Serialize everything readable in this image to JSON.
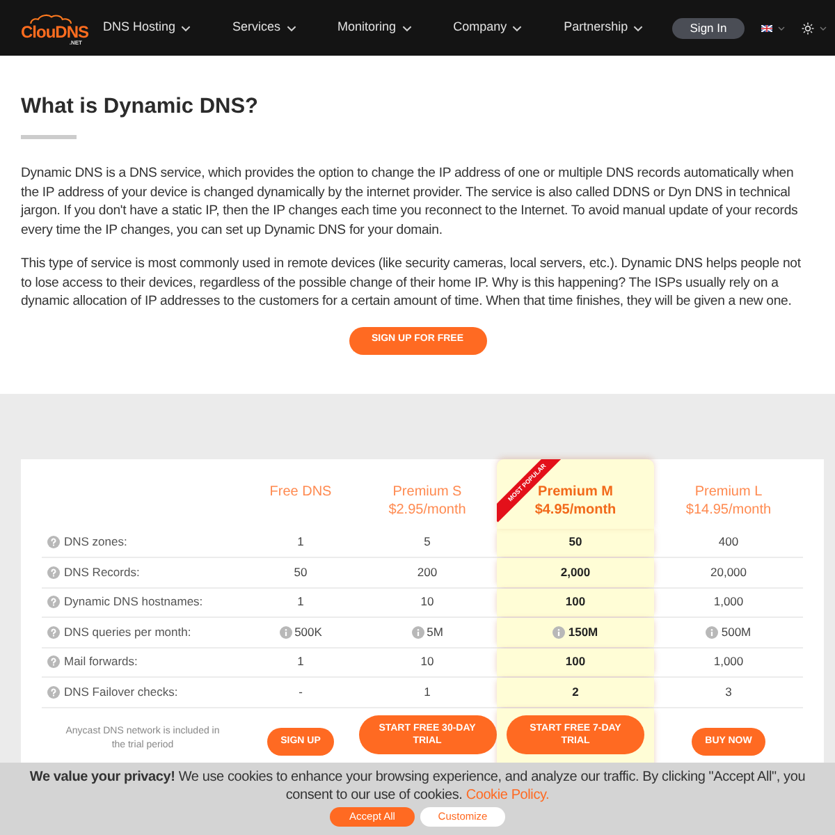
{
  "header": {
    "logo": {
      "text": "ClouDNS",
      "suffix": ".NET"
    },
    "nav": [
      {
        "label": "DNS Hosting"
      },
      {
        "label": "Services"
      },
      {
        "label": "Monitoring"
      },
      {
        "label": "Company"
      },
      {
        "label": "Partnership"
      }
    ],
    "sign_in": "Sign In",
    "dark_mode": false
  },
  "intro": {
    "title": "What is Dynamic DNS?",
    "paragraphs": [
      "Dynamic DNS is a DNS service, which provides the option to change the IP address of one or multiple DNS records automatically when the IP address of your device is changed dynamically by the internet provider. The service is also called DDNS or Dyn DNS in technical jargon. If you don't have a static IP, then the IP changes each time you reconnect to the Internet. To avoid manual update of your records every time the IP changes, you can set up Dynamic DNS for your domain.",
      "This type of service is most commonly used in remote devices (like security cameras, local servers, etc.). Dynamic DNS helps people not to lose access to their devices, regardless of the possible change of their home IP. Why is this happening? The ISPs usually rely on a dynamic allocation of IP addresses to the customers for a certain amount of time. When that time finishes, they will be given a new one."
    ],
    "button": "SIGN UP FOR FREE"
  },
  "pricing": {
    "plans": [
      {
        "name": "Free DNS",
        "featured": false
      },
      {
        "name": "Premium S",
        "price": "$2.95/month",
        "featured": false
      },
      {
        "name": "Premium M",
        "price": "$4.95/month",
        "featured": true,
        "ribbon": "MOST POPULAR"
      },
      {
        "name": "Premium L",
        "price": "$14.95/month",
        "featured": false
      }
    ],
    "rows": [
      {
        "label": "DNS zones:",
        "info": false,
        "values": [
          "1",
          "5",
          "50",
          "400"
        ]
      },
      {
        "label": "DNS Records:",
        "info": false,
        "values": [
          "50",
          "200",
          "2,000",
          "20,000"
        ]
      },
      {
        "label": "Dynamic DNS hostnames:",
        "info": false,
        "values": [
          "1",
          "10",
          "100",
          "1,000"
        ]
      },
      {
        "label": "DNS queries per month:",
        "info": true,
        "values": [
          "500K",
          "5M",
          "150M",
          "500M"
        ]
      },
      {
        "label": "Mail forwards:",
        "info": false,
        "values": [
          "1",
          "10",
          "100",
          "1,000"
        ]
      },
      {
        "label": "DNS Failover checks:",
        "info": false,
        "values": [
          "-",
          "1",
          "2",
          "3"
        ]
      }
    ],
    "note": "Anycast DNS network is included in the trial period",
    "actions": [
      "SIGN UP",
      "START FREE 30-DAY TRIAL",
      "START FREE 7-DAY TRIAL",
      "BUY NOW"
    ]
  },
  "cookie_banner": {
    "text": "**We value your privacy!** We use cookies to enhance your browsing experience, and analyze our traffic. By clicking \"Accept All\", you consent to our use of cookies.",
    "link": "Cookie Policy.",
    "buttons": [
      {
        "label": "Accept All",
        "kind": "primary"
      },
      {
        "label": "Customize",
        "kind": "secondary"
      }
    ]
  }
}
